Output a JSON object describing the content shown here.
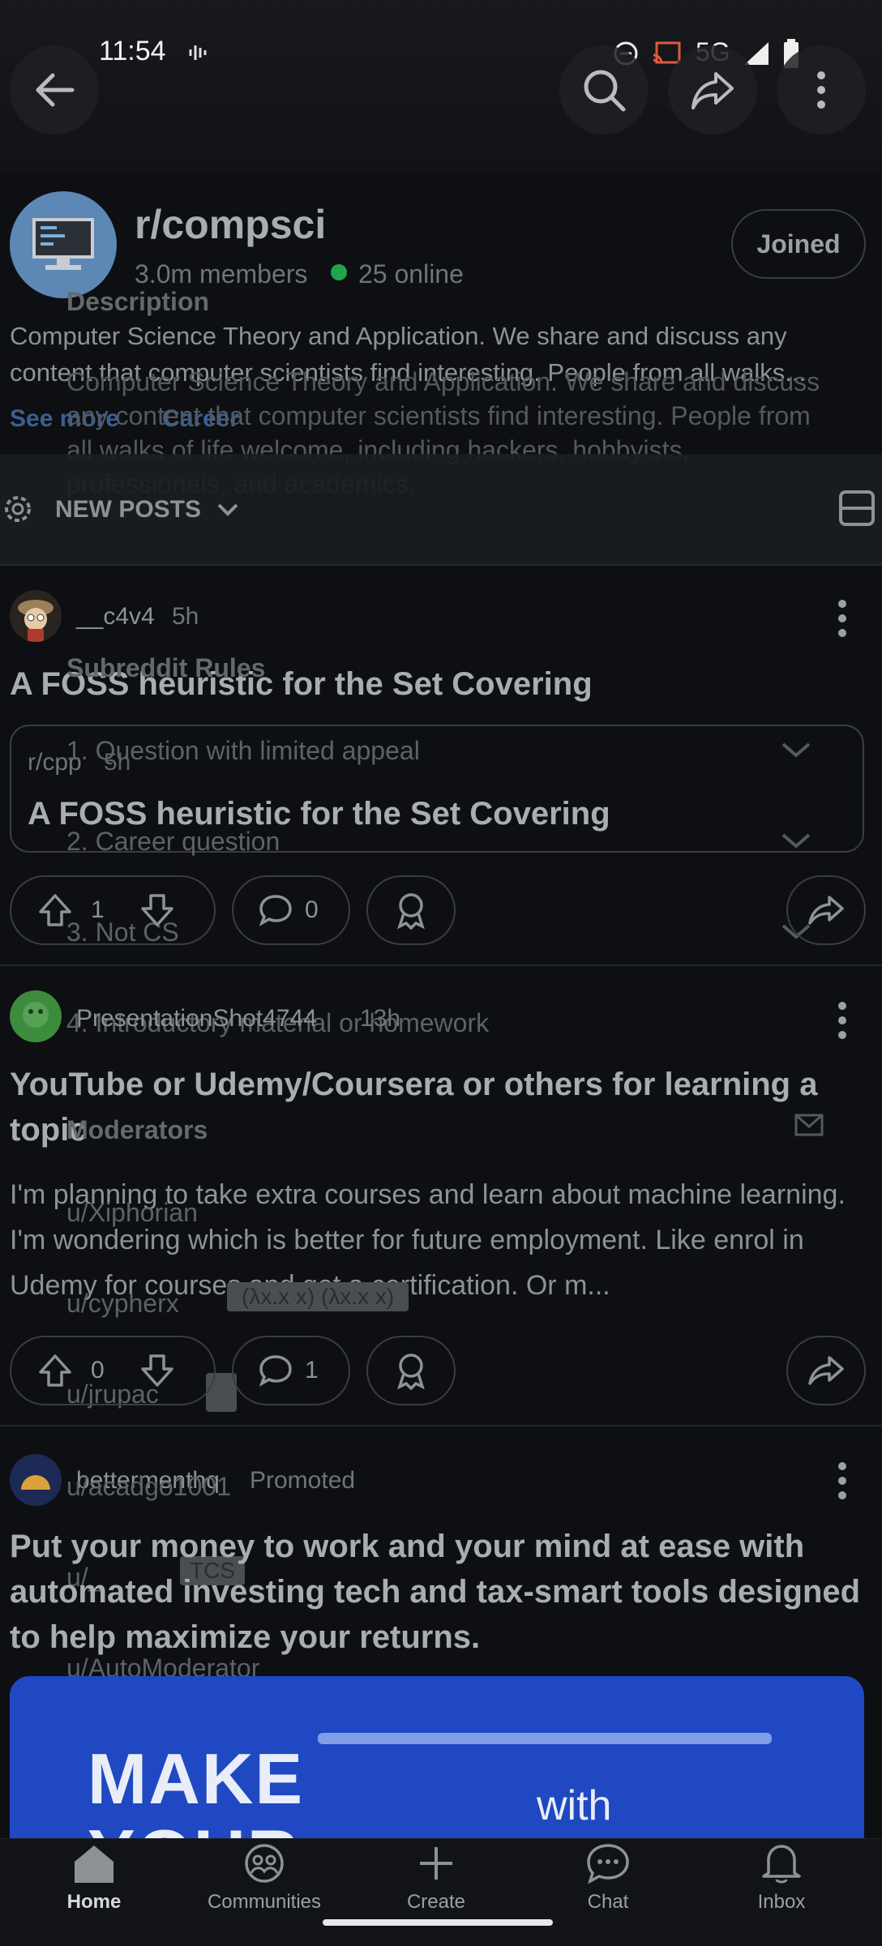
{
  "status_bar": {
    "time": "11:54",
    "network": "5G"
  },
  "subreddit": {
    "name": "r/compsci",
    "members": "3.0m members",
    "online": "25 online",
    "joined_label": "Joined",
    "description": "Computer Science Theory and Application. We share and discuss any content that computer scientists find interesting. People from all walks...",
    "see_more": "See more",
    "flair": "Career"
  },
  "ghost_overlay": {
    "description_heading": "Description",
    "description_text": "Computer Science Theory and Application. We share and discuss any content that computer scientists find interesting. People from all walks of life welcome, including hackers, hobbyists, professionals, and academics.",
    "rules_heading": "Subreddit Rules",
    "rules": [
      "1. Question with limited appeal",
      "2. Career question",
      "3. Not CS",
      "4. Introductory material or homework"
    ],
    "moderators_heading": "Moderators",
    "moderators": [
      "u/Xiphorian",
      "u/cypherx",
      "u/jrupac",
      "u/acadgo1001",
      "u/_",
      "u/AutoModerator"
    ],
    "flair_1": "(λx.x x) (λx.x x)",
    "flair_2": "TCS"
  },
  "sort": {
    "label": "NEW POSTS"
  },
  "posts": [
    {
      "author": "__c4v4",
      "time": "5h",
      "title": "A FOSS heuristic for the Set Covering",
      "crosspost": {
        "sub": "r/cpp",
        "time": "5h",
        "title": "A FOSS heuristic for the Set Covering"
      },
      "votes": "1",
      "comments": "0"
    },
    {
      "author": "PresentationShot4744",
      "time": "13h",
      "title": "YouTube or Udemy/Coursera or others for learning a topic",
      "body": "I'm planning to take extra courses and learn about machine learning. I'm wondering which is better for future employment. Like enrol in Udemy for courses and get a certification. Or m...",
      "votes": "0",
      "comments": "1"
    },
    {
      "author": "bettermenthq",
      "tag": "Promoted",
      "title": "Put your money to work and your mind at ease with automated investing tech and tax-smart tools designed to help maximize your returns.",
      "ad_text_1": "MAKE",
      "ad_text_2": "YOUR",
      "ad_text_3": "with"
    }
  ],
  "bottom_nav": {
    "home": "Home",
    "communities": "Communities",
    "create": "Create",
    "chat": "Chat",
    "inbox": "Inbox"
  }
}
